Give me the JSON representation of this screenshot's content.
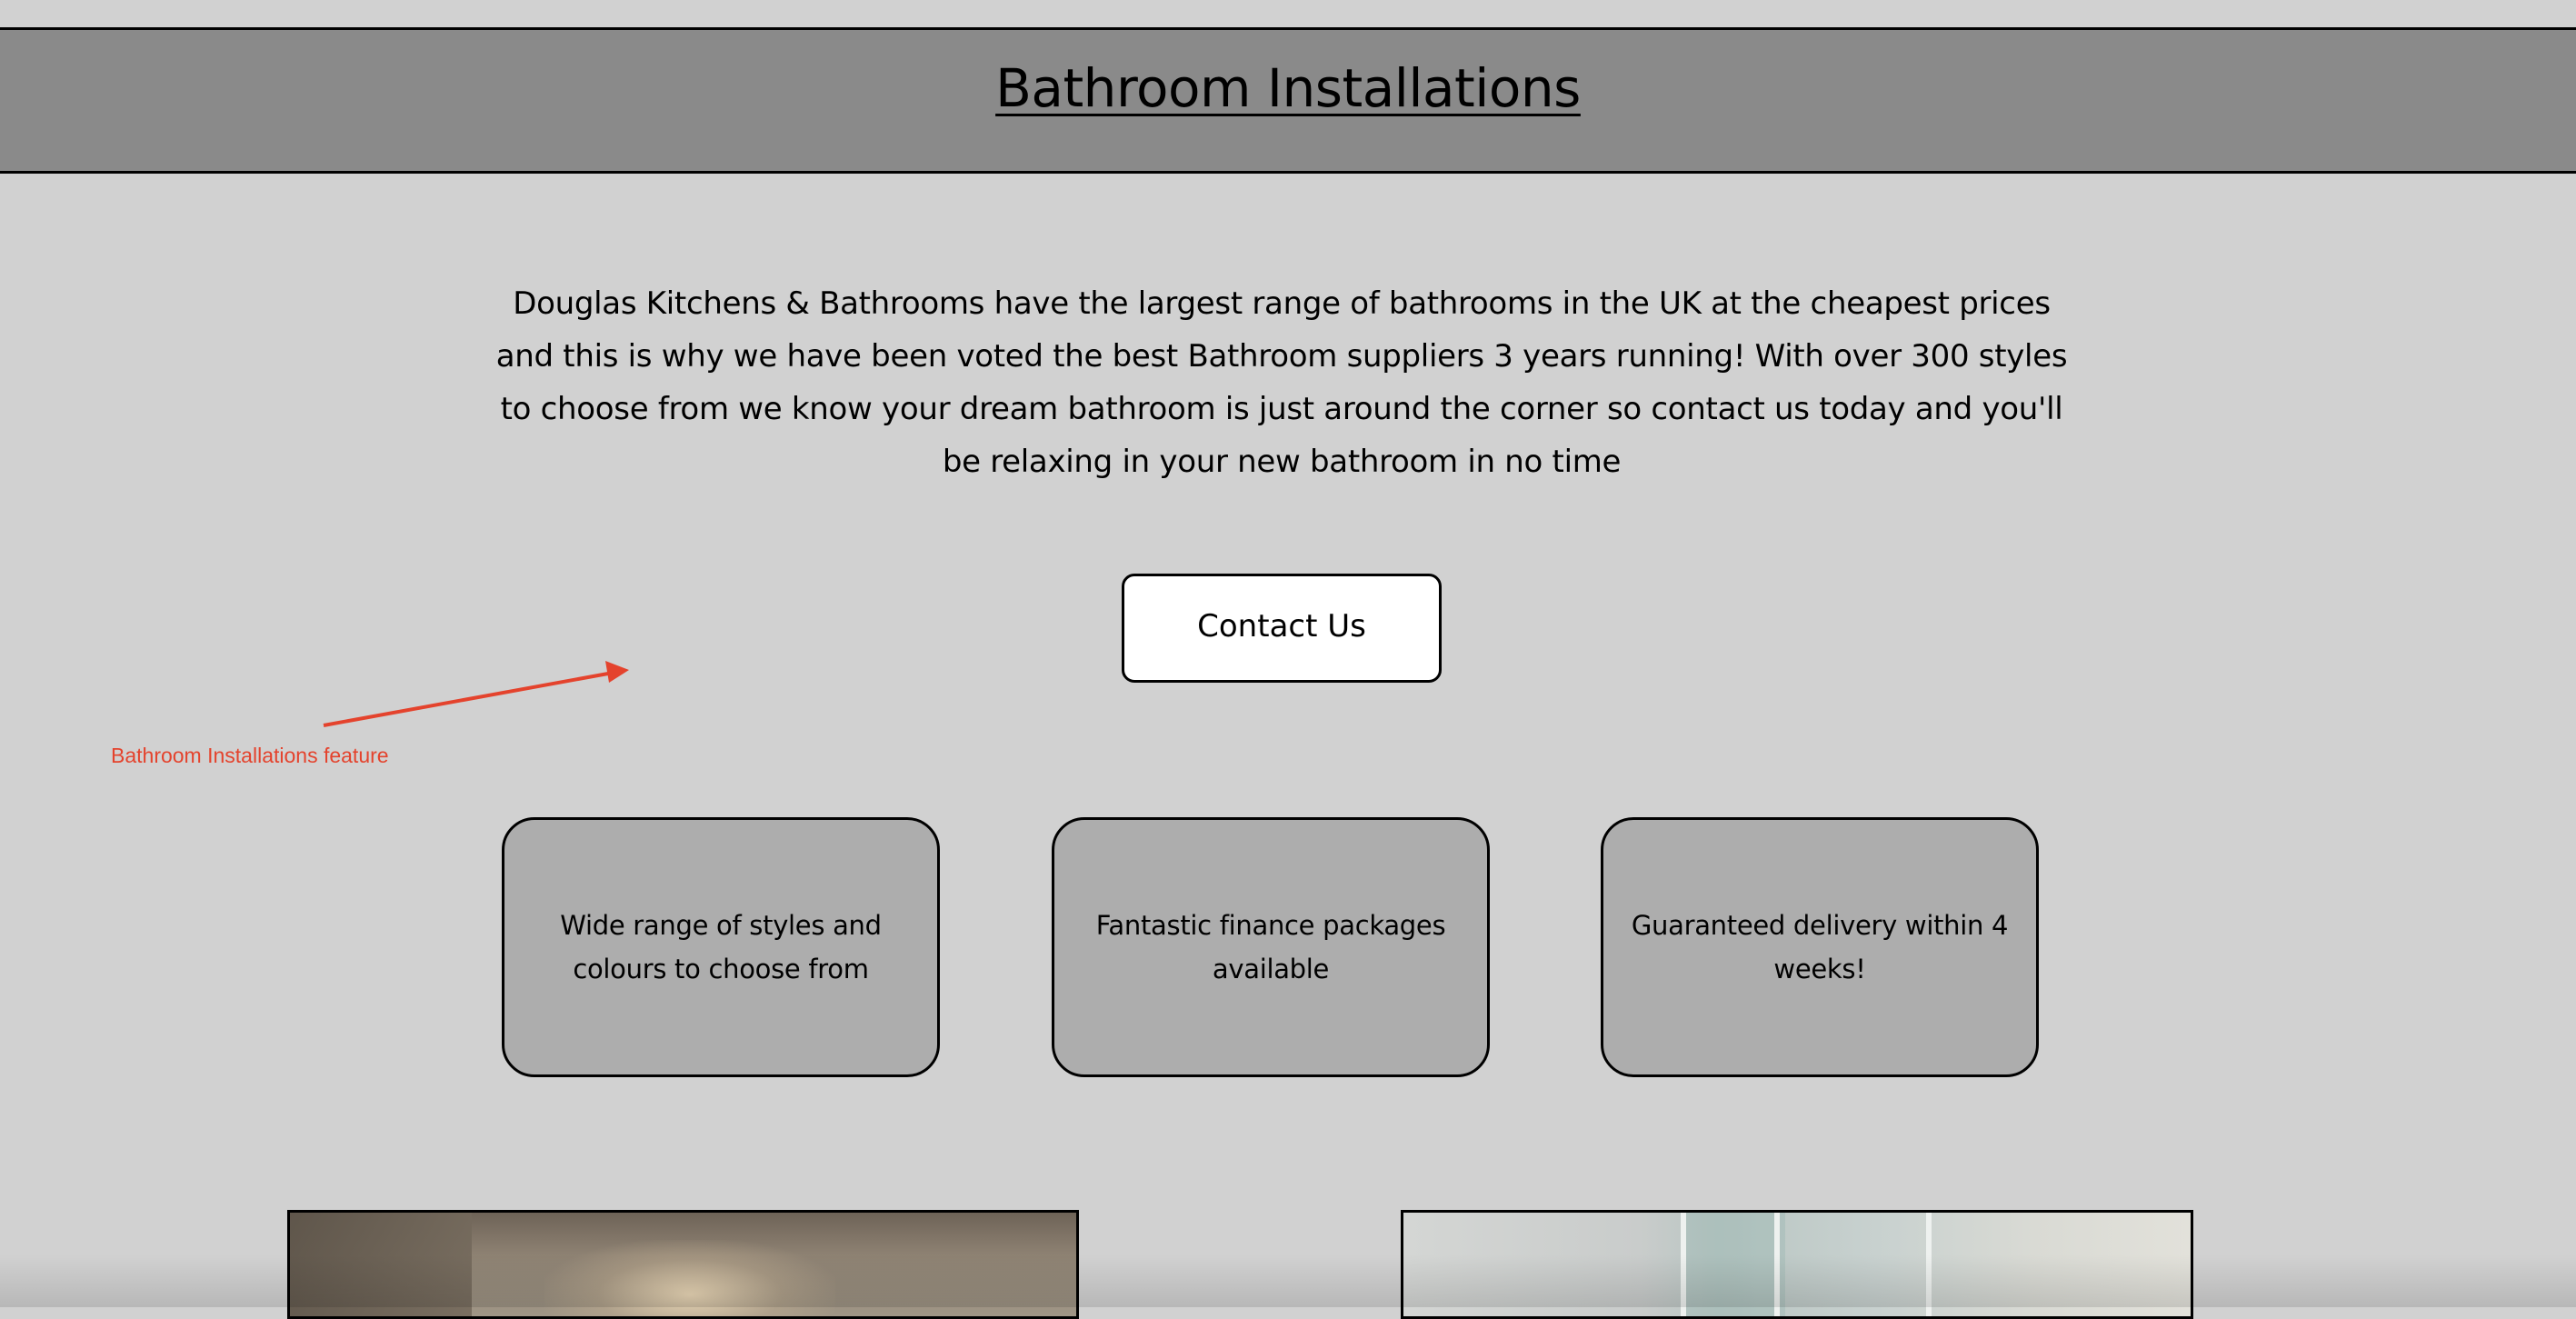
{
  "header": {
    "title": "Bathroom Installations"
  },
  "intro": {
    "text": "Douglas Kitchens & Bathrooms have the largest range of bathrooms in the UK at the cheapest prices and this is why we have been voted the best Bathroom suppliers 3 years running! With over 300 styles to choose from we know your dream bathroom is just around the corner so contact us today and you'll be relaxing in your new bathroom in no time"
  },
  "contact_button": {
    "label": "Contact Us"
  },
  "annotation": {
    "label": "Bathroom Installations feature",
    "color": "#e4432d"
  },
  "features": [
    {
      "text": "Wide range of styles and colours to choose from"
    },
    {
      "text": "Fantastic finance packages available"
    },
    {
      "text": "Guaranteed delivery within 4 weeks!"
    }
  ],
  "colors": {
    "page_background": "#d1d1d1",
    "header_background": "#8a8a8a",
    "card_background": "#adadad",
    "button_background": "#ffffff"
  }
}
